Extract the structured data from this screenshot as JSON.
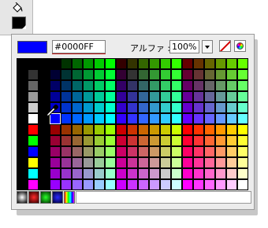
{
  "toolbar": {
    "tool_icon": "paint-bucket-icon",
    "fill_swatch_color": "#000000"
  },
  "picker": {
    "hex_value": "#0000FF",
    "current_color": "#0000FF",
    "alpha_label": "アルファ :",
    "alpha_value": "100%",
    "no_color_icon": "no-color-icon",
    "wheel_icon": "color-wheel-icon",
    "cursor_icon": "eyedropper-icon"
  },
  "swatches": {
    "column_count": 21,
    "row_count": 12,
    "left_column_1": [
      "#000000",
      "#000000",
      "#000000",
      "#000000",
      "#000000",
      "#000000",
      "#000000",
      "#000000",
      "#000000",
      "#000000",
      "#000000",
      "#000000"
    ],
    "left_column_2": [
      "#000000",
      "#333333",
      "#666666",
      "#999999",
      "#cccccc",
      "#ffffff",
      "#ff0000",
      "#00ff00",
      "#0000ff",
      "#ffff00",
      "#00ffff",
      "#ff00ff"
    ],
    "left_column_3": [
      "#000000",
      "#000000",
      "#000000",
      "#000000",
      "#000000",
      "#000000",
      "#000000",
      "#000000",
      "#000000",
      "#000000",
      "#000000",
      "#000000"
    ],
    "cube_levels": [
      "00",
      "33",
      "66",
      "99",
      "CC",
      "FF"
    ],
    "selected_color": "#0000FF"
  },
  "bottom_strip": {
    "gradients": [
      "white-black-radial",
      "red-radial",
      "green-radial",
      "blue-radial",
      "rainbow-linear"
    ]
  }
}
